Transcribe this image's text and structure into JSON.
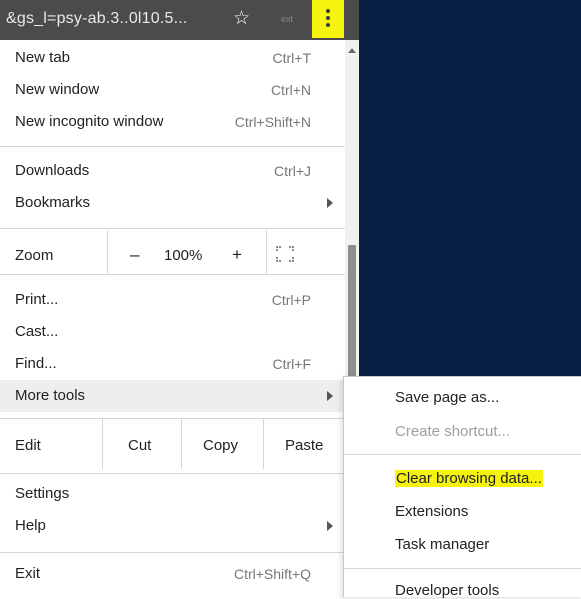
{
  "toolbar": {
    "url_fragment": "&gs_l=psy-ab.3..0l10.5...",
    "bookmark_icon": "star-icon",
    "extension_label": "ext",
    "menu_icon": "kebab-menu-icon",
    "highlight_color": "#f6f30f"
  },
  "menu": {
    "new_tab": {
      "label": "New tab",
      "shortcut": "Ctrl+T"
    },
    "new_window": {
      "label": "New window",
      "shortcut": "Ctrl+N"
    },
    "new_incognito": {
      "label": "New incognito window",
      "shortcut": "Ctrl+Shift+N"
    },
    "downloads": {
      "label": "Downloads",
      "shortcut": "Ctrl+J"
    },
    "bookmarks": {
      "label": "Bookmarks"
    },
    "zoom": {
      "label": "Zoom",
      "minus": "–",
      "value": "100%",
      "plus": "+"
    },
    "print": {
      "label": "Print...",
      "shortcut": "Ctrl+P"
    },
    "cast": {
      "label": "Cast..."
    },
    "find": {
      "label": "Find...",
      "shortcut": "Ctrl+F"
    },
    "more_tools": {
      "label": "More tools"
    },
    "edit": {
      "label": "Edit",
      "cut": "Cut",
      "copy": "Copy",
      "paste": "Paste"
    },
    "settings": {
      "label": "Settings"
    },
    "help": {
      "label": "Help"
    },
    "exit": {
      "label": "Exit",
      "shortcut": "Ctrl+Shift+Q"
    }
  },
  "submenu": {
    "save_page": "Save page as...",
    "create_shortcut": "Create shortcut...",
    "clear_browsing": "Clear browsing data...",
    "extensions": "Extensions",
    "task_manager": "Task manager",
    "developer_tools": "Developer tools"
  },
  "colors": {
    "page_background": "#0a1f44",
    "toolbar": "#4b4b4b",
    "hover": "#eeeeee"
  }
}
